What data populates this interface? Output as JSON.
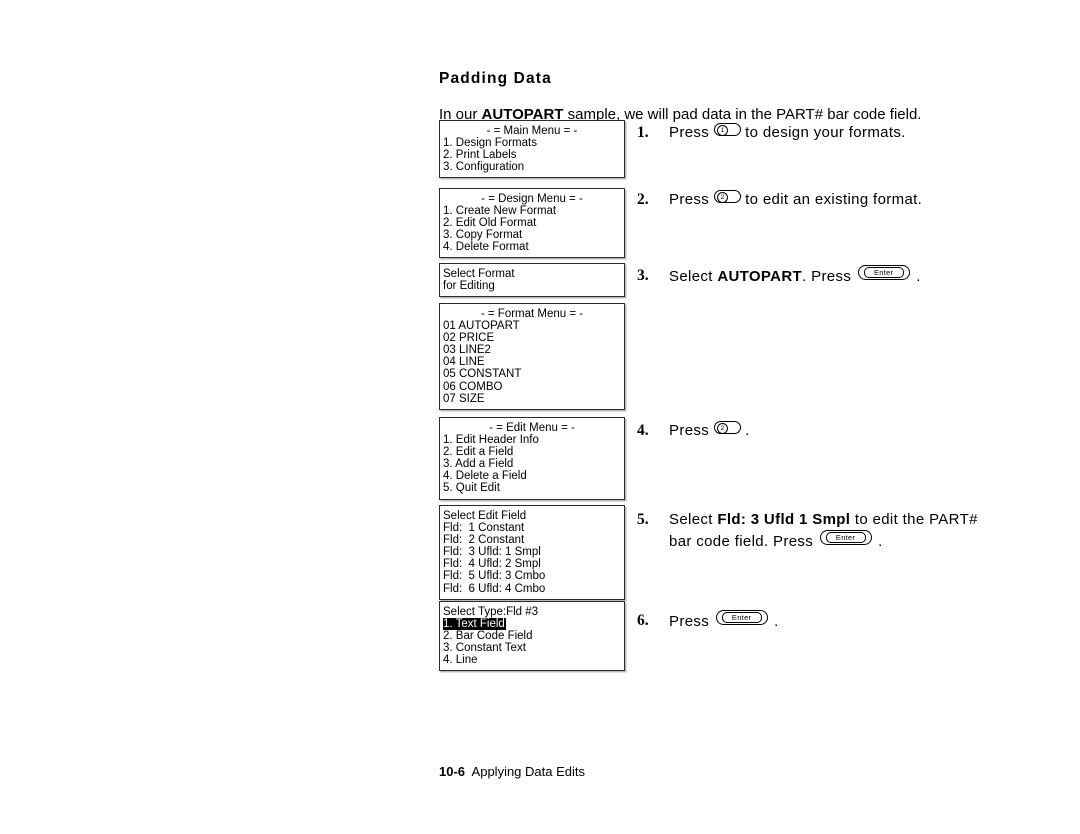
{
  "heading": "Padding Data",
  "intro": {
    "before": "In our ",
    "emphasis": "AUTOPART",
    "after": " sample, we will pad data in the PART# bar code field."
  },
  "screens": [
    {
      "id": "main-menu",
      "name": "main-menu-screen",
      "title": "- = Main Menu = -",
      "lines": [
        "1. Design Formats",
        "2. Print Labels",
        "3. Configuration"
      ],
      "selected": null
    },
    {
      "id": "design-menu",
      "name": "design-menu-screen",
      "title": "- = Design Menu = -",
      "lines": [
        "1. Create New Format",
        "2. Edit Old Format",
        "3. Copy Format",
        "4. Delete Format"
      ],
      "selected": null
    },
    {
      "id": "select-format",
      "name": "select-format-screen",
      "title": null,
      "lines": [
        "Select Format",
        "for Editing"
      ],
      "selected": null
    },
    {
      "id": "format-menu",
      "name": "format-menu-screen",
      "title": "- = Format Menu = -",
      "lines": [
        "01 AUTOPART",
        "02 PRICE",
        "03 LINE2",
        "04 LINE",
        "05 CONSTANT",
        "06 COMBO",
        "07 SIZE"
      ],
      "selected": null
    },
    {
      "id": "edit-menu",
      "name": "edit-menu-screen",
      "title": "- = Edit Menu = -",
      "lines": [
        "1. Edit Header Info",
        "2. Edit a Field",
        "3. Add a Field",
        "4. Delete a Field",
        "5. Quit Edit"
      ],
      "selected": null
    },
    {
      "id": "select-edit",
      "name": "select-edit-field-screen",
      "title": null,
      "lines": [
        "Select Edit Field",
        "Fld:  1 Constant",
        "Fld:  2 Constant",
        "Fld:  3 Ufld: 1 Smpl",
        "Fld:  4 Ufld: 2 Smpl",
        "Fld:  5 Ufld: 3 Cmbo",
        "Fld:  6 Ufld: 4 Cmbo"
      ],
      "selected": null
    },
    {
      "id": "select-type",
      "name": "select-type-screen",
      "title": null,
      "lines": [
        "Select Type:Fld #3",
        "1. Text Field",
        "2. Bar Code Field",
        "3. Constant Text",
        "4. Line"
      ],
      "selected": 2
    }
  ],
  "steps": [
    {
      "id": "step-1",
      "num": "1.",
      "name": "step-press-1",
      "parts": [
        {
          "t": "text",
          "v": "Press "
        },
        {
          "t": "key-num",
          "v": "1"
        },
        {
          "t": "text",
          "v": " to design your formats."
        }
      ]
    },
    {
      "id": "step-2",
      "num": "2.",
      "name": "step-press-2-edit-format",
      "parts": [
        {
          "t": "text",
          "v": "Press "
        },
        {
          "t": "key-num",
          "v": "2"
        },
        {
          "t": "text",
          "v": " to edit an existing format."
        }
      ]
    },
    {
      "id": "step-3",
      "num": "3.",
      "name": "step-select-autopart",
      "parts": [
        {
          "t": "text",
          "v": "Select "
        },
        {
          "t": "bold",
          "v": "AUTOPART"
        },
        {
          "t": "text",
          "v": ".  Press "
        },
        {
          "t": "key-enter",
          "v": "Enter"
        },
        {
          "t": "text",
          "v": " ."
        }
      ]
    },
    {
      "id": "step-4",
      "num": "4.",
      "name": "step-press-2-edit-a-field",
      "parts": [
        {
          "t": "text",
          "v": "Press "
        },
        {
          "t": "key-num",
          "v": "2"
        },
        {
          "t": "text",
          "v": " ."
        }
      ]
    },
    {
      "id": "step-5",
      "num": "5.",
      "name": "step-select-field-3",
      "parts": [
        {
          "t": "text",
          "v": "Select "
        },
        {
          "t": "bold",
          "v": "Fld:  3 Ufld 1 Smpl"
        },
        {
          "t": "text",
          "v": " to edit the PART#"
        },
        {
          "t": "br"
        },
        {
          "t": "text",
          "v": "bar code field.  Press "
        },
        {
          "t": "key-enter",
          "v": "Enter"
        },
        {
          "t": "text",
          "v": " ."
        }
      ]
    },
    {
      "id": "step-6",
      "num": "6.",
      "name": "step-press-enter",
      "parts": [
        {
          "t": "text",
          "v": "Press "
        },
        {
          "t": "key-enter",
          "v": "Enter"
        },
        {
          "t": "text",
          "v": " ."
        }
      ]
    }
  ],
  "footer": {
    "folio": "10-6",
    "chapter": "Applying Data Edits"
  },
  "colors": {
    "text": "#000000",
    "background": "#ffffff",
    "box_border": "#2b2b2b",
    "box_shadow": "#b9b9b9",
    "highlight_bg": "#000000",
    "highlight_fg": "#ffffff"
  }
}
